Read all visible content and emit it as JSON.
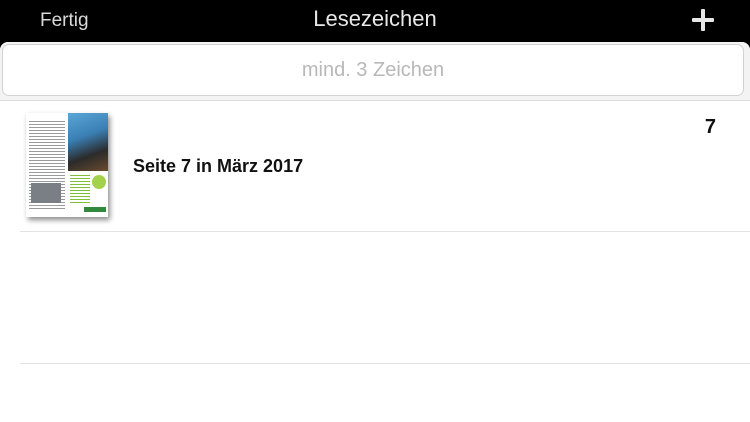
{
  "navbar": {
    "done_label": "Fertig",
    "title": "Lesezeichen",
    "add_icon": "plus-icon"
  },
  "search": {
    "placeholder": "mind. 3 Zeichen",
    "value": ""
  },
  "bookmarks": [
    {
      "title": "Seite 7 in März 2017",
      "page": "7",
      "thumbnail": "magazine-cover-thumbnail"
    }
  ]
}
